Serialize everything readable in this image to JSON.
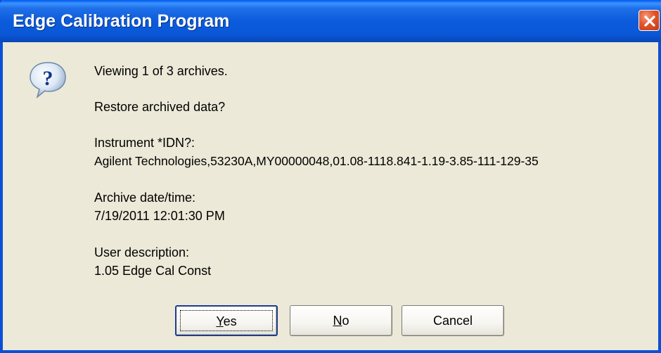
{
  "window": {
    "title": "Edge Calibration Program"
  },
  "icons": {
    "titlebar_close": "close-icon",
    "message": "question-icon"
  },
  "message": {
    "viewing": "Viewing 1 of 3 archives.",
    "prompt": "Restore archived data?",
    "instrument_label": "Instrument *IDN?:",
    "instrument_value": "Agilent Technologies,53230A,MY00000048,01.08-1118.841-1.19-3.85-111-129-35",
    "archive_label": "Archive date/time:",
    "archive_value": "7/19/2011 12:01:30 PM",
    "description_label": "User description:",
    "description_value": "1.05 Edge Cal Const"
  },
  "buttons": {
    "yes": {
      "accel": "Y",
      "rest": "es"
    },
    "no": {
      "accel": "N",
      "rest": "o"
    },
    "cancel": "Cancel"
  },
  "colors": {
    "titlebar": "#0a58d8",
    "dialog_bg": "#ece9d8",
    "close_button": "#e2542b"
  }
}
